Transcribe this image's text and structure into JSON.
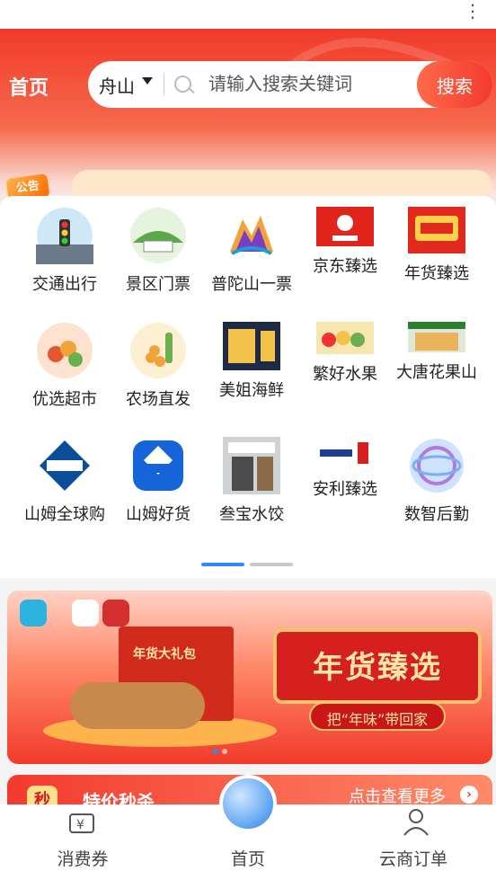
{
  "top_menu": {
    "icon": "more-vertical-icon"
  },
  "header": {
    "title": "首页",
    "city": "舟山",
    "search_placeholder": "请输入搜索关键词",
    "search_button": "搜索",
    "notice_badge": "公告"
  },
  "grid": {
    "items": [
      {
        "label": "交通出行",
        "icon": "traffic-light-icon"
      },
      {
        "label": "景区门票",
        "icon": "scenic-ticket-icon"
      },
      {
        "label": "普陀山一票",
        "icon": "putuo-mountain-icon"
      },
      {
        "label": "京东臻选",
        "icon": "jd-logo-icon"
      },
      {
        "label": "年货臻选",
        "icon": "new-year-goods-icon"
      },
      {
        "label": "优选超市",
        "icon": "supermarket-icon"
      },
      {
        "label": "农场直发",
        "icon": "farm-direct-icon"
      },
      {
        "label": "美姐海鲜",
        "icon": "seafood-icon"
      },
      {
        "label": "繁好水果",
        "icon": "fruit-icon"
      },
      {
        "label": "大唐花果山",
        "icon": "fruit-store-icon"
      },
      {
        "label": "山姆全球购",
        "icon": "sams-club-icon"
      },
      {
        "label": "山姆好货",
        "icon": "sams-goods-icon"
      },
      {
        "label": "叁宝水饺",
        "icon": "dumpling-shop-icon"
      },
      {
        "label": "安利臻选",
        "icon": "amway-logo-icon"
      },
      {
        "label": "数智后勤",
        "icon": "digital-logistics-icon"
      }
    ],
    "page_count": 2,
    "active_page": 1
  },
  "banner": {
    "title": "年货臻选",
    "subtitle": "把“年味”带回家",
    "bag_text": "年货大礼包",
    "slide_count": 2,
    "active_slide": 1
  },
  "promo": {
    "tag": "秒",
    "title": "特价秒杀",
    "more": "点击查看更多"
  },
  "tabbar": {
    "tabs": [
      {
        "label": "消费券",
        "icon": "coupon-icon"
      },
      {
        "label": "首页",
        "icon": "home-globe-icon"
      },
      {
        "label": "云商订单",
        "icon": "user-icon"
      }
    ]
  },
  "colors": {
    "brand_red": "#f23a2a",
    "search_button": "#f33a2e",
    "active_dot": "#2f8bf0",
    "inactive_dot": "#c8c8c8"
  }
}
